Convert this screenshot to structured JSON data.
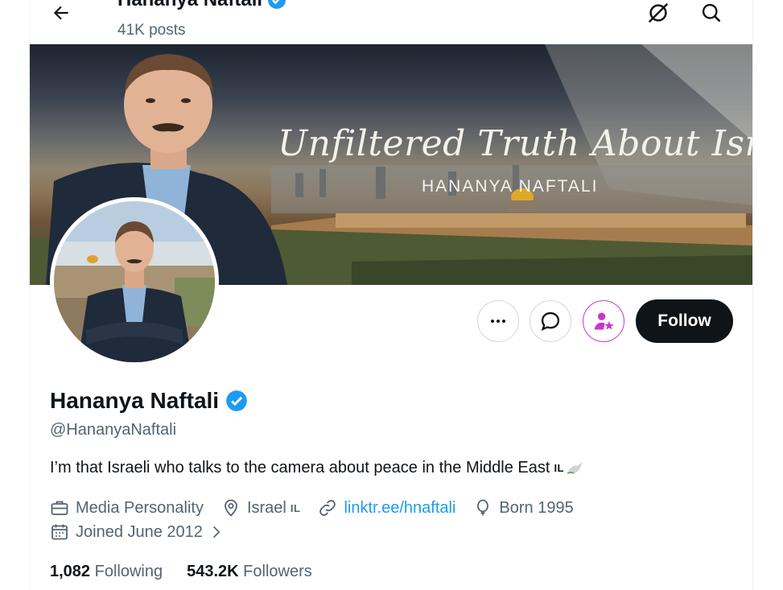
{
  "header": {
    "name": "Hananya Naftali",
    "posts_count": "41K posts"
  },
  "banner": {
    "title": "Unfiltered Truth About Israel",
    "subtitle": "HANANYA NAFTALI"
  },
  "actions": {
    "follow_label": "Follow"
  },
  "profile": {
    "name": "Hananya Naftali",
    "handle": "@HananyaNaftali",
    "bio": "I’m that Israeli who talks to the camera about peace in the Middle East",
    "bio_flag": "IL",
    "category": "Media Personality",
    "location": "Israel",
    "location_flag": "IL",
    "website": "linktr.ee/hnaftali",
    "birth": "Born 1995",
    "joined": "Joined June 2012",
    "following_count": "1,082",
    "following_label": "Following",
    "followers_count": "543.2K",
    "followers_label": "Followers"
  },
  "colors": {
    "accent": "#1d9bf0",
    "text": "#0f1419",
    "secondary": "#536471",
    "verified": "#1d9bf0",
    "subscribe_accent": "#c936c9"
  },
  "icons": [
    "back-arrow-icon",
    "grok-icon",
    "search-icon",
    "more-icon",
    "message-icon",
    "subscribe-icon",
    "verified-icon",
    "briefcase-icon",
    "location-pin-icon",
    "link-icon",
    "balloon-icon",
    "calendar-icon",
    "chevron-right-icon",
    "dove-icon"
  ]
}
